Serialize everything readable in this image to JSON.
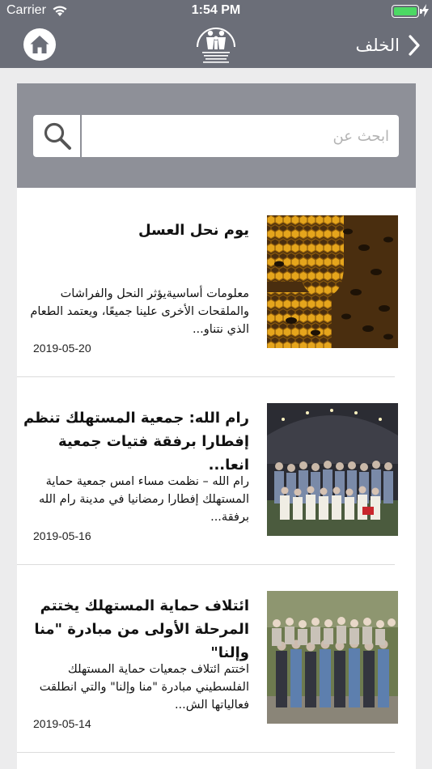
{
  "status_bar": {
    "carrier": "Carrier",
    "time": "1:54 PM",
    "battery_level": 1.0,
    "battery_color": "#4cd964"
  },
  "nav": {
    "back_label": "الخلف",
    "back_icon": "chevron-right-icon",
    "home_icon": "home-icon",
    "logo": {
      "line1": "Palestinian Society",
      "line2": "for Consumer Protection",
      "line3": "جمعية حماية المستهلك الفلسطيني"
    },
    "bar_color": "#6b6e78"
  },
  "search": {
    "placeholder": "ابحث عن",
    "value": "",
    "icon": "search-icon"
  },
  "articles": [
    {
      "title": "يوم نحل العسل",
      "excerpt": "معلومات أساسيةيؤثر النحل والفراشات والملقحات الأخرى علينا جميعًا، ويعتمد الطعام الذي نتناو...",
      "date": "2019-05-20",
      "image": "honeycomb-with-bees-photo"
    },
    {
      "title": "رام الله: جمعية المستهلك تنظم إفطارا برفقة فتيات جمعية انعا...",
      "excerpt": "رام الله – نظمت مساء امس جمعية حماية المستهلك إفطارا رمضانيا في مدينة رام الله برفقة...",
      "date": "2019-05-16",
      "image": "group-photo-under-tent"
    },
    {
      "title": "ائتلاف حماية المستهلك يختتم المرحلة الأولى من مبادرة \"منا وإلنا\"",
      "excerpt": "اختتم ائتلاف جمعيات حماية المستهلك الفلسطيني مبادرة \"منا وإلنا\" والتي انطلقت فعالياتها الش...",
      "date": "2019-05-14",
      "image": "group-photo-outdoors"
    }
  ]
}
